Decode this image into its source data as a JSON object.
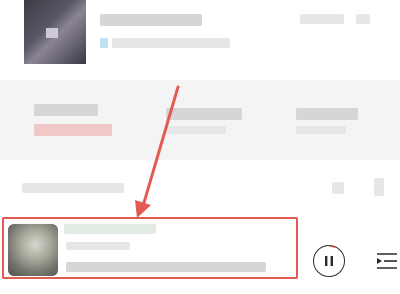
{
  "colors": {
    "annotation_red": "#e25b52",
    "band_gray": "#f4f4f4",
    "progress_ring": "#d94a3d"
  },
  "icons": {
    "pause": "pause-icon",
    "playlist": "playlist-icon"
  }
}
